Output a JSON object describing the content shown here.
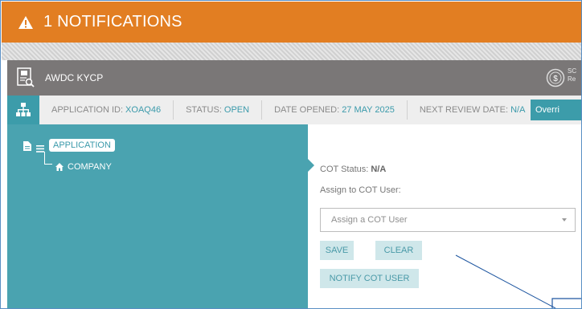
{
  "notification_bar": {
    "text": "1 NOTIFICATIONS",
    "icon": "warning-icon",
    "color": "#e27e22"
  },
  "app_header": {
    "app_name": "AWDC KYCP",
    "app_icon": "document-search-icon",
    "right_icon": "dollar-circle-icon",
    "right_text_line1": "SC",
    "right_text_line2": "Re"
  },
  "info_bar": {
    "tree_icon": "sitemap-icon",
    "application_id_label": "APPLICATION ID:",
    "application_id_value": "XOAQ46",
    "status_label": "STATUS:",
    "status_value": "OPEN",
    "date_opened_label": "DATE OPENED:",
    "date_opened_value": "27 MAY 2025",
    "next_review_label": "NEXT REVIEW DATE:",
    "next_review_value": "N/A",
    "override_button": "Overri"
  },
  "tree": {
    "root_label": "APPLICATION",
    "child_label": "COMPANY"
  },
  "form": {
    "cot_status_label": "COT Status:",
    "cot_status_value": "N/A",
    "assign_label": "Assign to COT User:",
    "select_placeholder": "Assign a COT User",
    "save_button": "SAVE",
    "clear_button": "CLEAR",
    "notify_button": "NOTIFY COT USER"
  },
  "colors": {
    "teal": "#4aa3b0",
    "teal_dark": "#3c9caa",
    "header_gray": "#7a7777",
    "button_bg": "#cfe7ea"
  }
}
